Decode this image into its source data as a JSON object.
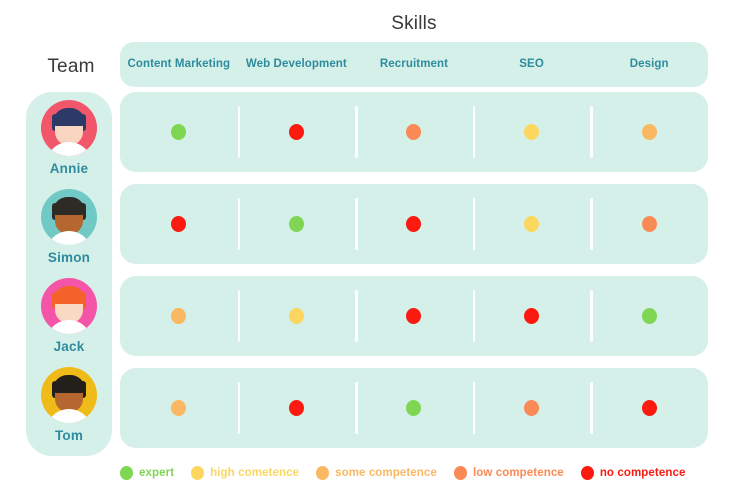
{
  "header": {
    "skills_title": "Skills",
    "team_title": "Team"
  },
  "columns": [
    {
      "label": "Content Marketing"
    },
    {
      "label": "Web Development"
    },
    {
      "label": "Recruitment"
    },
    {
      "label": "SEO"
    },
    {
      "label": "Design"
    }
  ],
  "colors": {
    "panel": "#D5F0E8",
    "header_text": "#2E8C9E",
    "title_text": "#3A3A3A",
    "separator": "#FFFFFF",
    "expert": "#7FD653",
    "high": "#FCD65E",
    "some": "#FBB862",
    "low": "#FA8A55",
    "none": "#FB1A10"
  },
  "members": [
    {
      "name": "Annie",
      "avatar": {
        "bg": "#F2566A",
        "hair": "#2B3A67",
        "skin": "#F7D5BE",
        "shirt": "#FFFFFF"
      }
    },
    {
      "name": "Simon",
      "avatar": {
        "bg": "#71C9C6",
        "hair": "#2E2A26",
        "skin": "#B5672F",
        "shirt": "#FFFFFF"
      }
    },
    {
      "name": "Jack",
      "avatar": {
        "bg": "#F455A8",
        "hair": "#F4622A",
        "skin": "#FAD9C2",
        "shirt": "#FFFFFF"
      }
    },
    {
      "name": "Tom",
      "avatar": {
        "bg": "#EFBB19",
        "hair": "#23201C",
        "skin": "#B5672F",
        "shirt": "#FFFFFF"
      }
    }
  ],
  "legend": [
    {
      "key": "expert",
      "label": "expert",
      "color": "#7FD653"
    },
    {
      "key": "high",
      "label": "high cometence",
      "color": "#FCD65E"
    },
    {
      "key": "some",
      "label": "some competence",
      "color": "#FBB862"
    },
    {
      "key": "low",
      "label": "low competence",
      "color": "#FA8A55"
    },
    {
      "key": "none",
      "label": "no competence",
      "color": "#FB1A10"
    }
  ],
  "chart_data": {
    "type": "heatmap",
    "title": "Skills",
    "xlabel": "Skills",
    "ylabel": "Team",
    "categories": [
      "Content Marketing",
      "Web Development",
      "Recruitment",
      "SEO",
      "Design"
    ],
    "levels": [
      "expert",
      "high",
      "some",
      "low",
      "none"
    ],
    "series": [
      {
        "name": "Annie",
        "values": [
          "expert",
          "none",
          "low",
          "high",
          "some"
        ]
      },
      {
        "name": "Simon",
        "values": [
          "none",
          "expert",
          "none",
          "high",
          "low"
        ]
      },
      {
        "name": "Jack",
        "values": [
          "some",
          "high",
          "none",
          "none",
          "expert"
        ]
      },
      {
        "name": "Tom",
        "values": [
          "some",
          "none",
          "expert",
          "low",
          "none"
        ]
      }
    ],
    "legend_position": "bottom",
    "grid": false
  }
}
